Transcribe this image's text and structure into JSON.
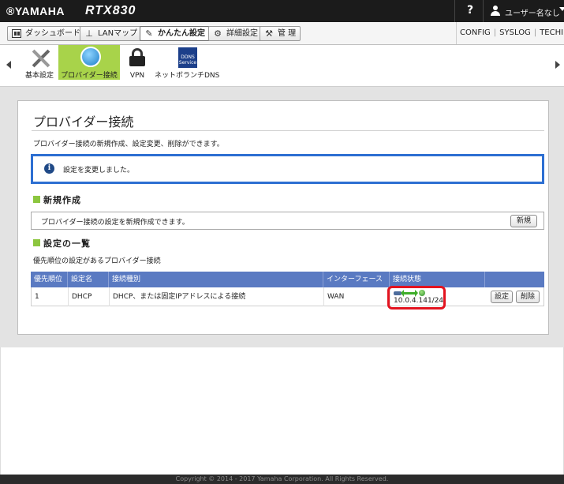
{
  "header": {
    "logo": "®YAMAHA",
    "model": "RTX830",
    "help": "?",
    "user_name": "ユーザー名なし"
  },
  "nav": {
    "tabs": [
      {
        "label": "ダッシュボード",
        "icon": "dashboard-icon"
      },
      {
        "label": "LANマップ",
        "icon": "lan-map-icon"
      },
      {
        "label": "かんたん設定",
        "icon": "easy-setup-icon"
      },
      {
        "label": "詳細設定",
        "icon": "gear-icon"
      },
      {
        "label": "管 理",
        "icon": "wrench-icon"
      }
    ],
    "right_links": [
      "CONFIG",
      "SYSLOG",
      "TECHINFO"
    ]
  },
  "toolbar": {
    "items": [
      {
        "label": "基本設定",
        "icon": "tools-icon"
      },
      {
        "label": "プロバイダー接続",
        "icon": "globe-icon"
      },
      {
        "label": "VPN",
        "icon": "lock-icon"
      },
      {
        "label": "ネットボランチDNS",
        "icon": "dns-service-icon",
        "icon_text": "DDNS Service"
      }
    ]
  },
  "page": {
    "title": "プロバイダー接続",
    "description": "プロバイダー接続の新規作成、設定変更、削除ができます。",
    "notice": "設定を変更しました。"
  },
  "new_section": {
    "title": "新規作成",
    "text": "プロバイダー接続の設定を新規作成できます。",
    "button": "新規"
  },
  "list_section": {
    "title": "設定の一覧",
    "description": "優先順位の設定があるプロバイダー接続",
    "columns": [
      "優先順位",
      "設定名",
      "接続種別",
      "インターフェース",
      "接続状態",
      ""
    ],
    "rows": [
      {
        "priority": "1",
        "name": "DHCP",
        "type": "DHCP、または固定IPアドレスによる接続",
        "interface": "WAN",
        "status_ip": "10.0.4.141/24",
        "edit_button": "設定",
        "delete_button": "削除"
      }
    ]
  },
  "footer": {
    "copyright": "Copyright © 2014 - 2017 Yamaha Corporation. All Rights Reserved."
  },
  "colors": {
    "accent_green": "#8cc63f",
    "notice_border": "#2d6fd2",
    "table_header": "#5a7ac2",
    "highlight_red": "#e3131f"
  }
}
